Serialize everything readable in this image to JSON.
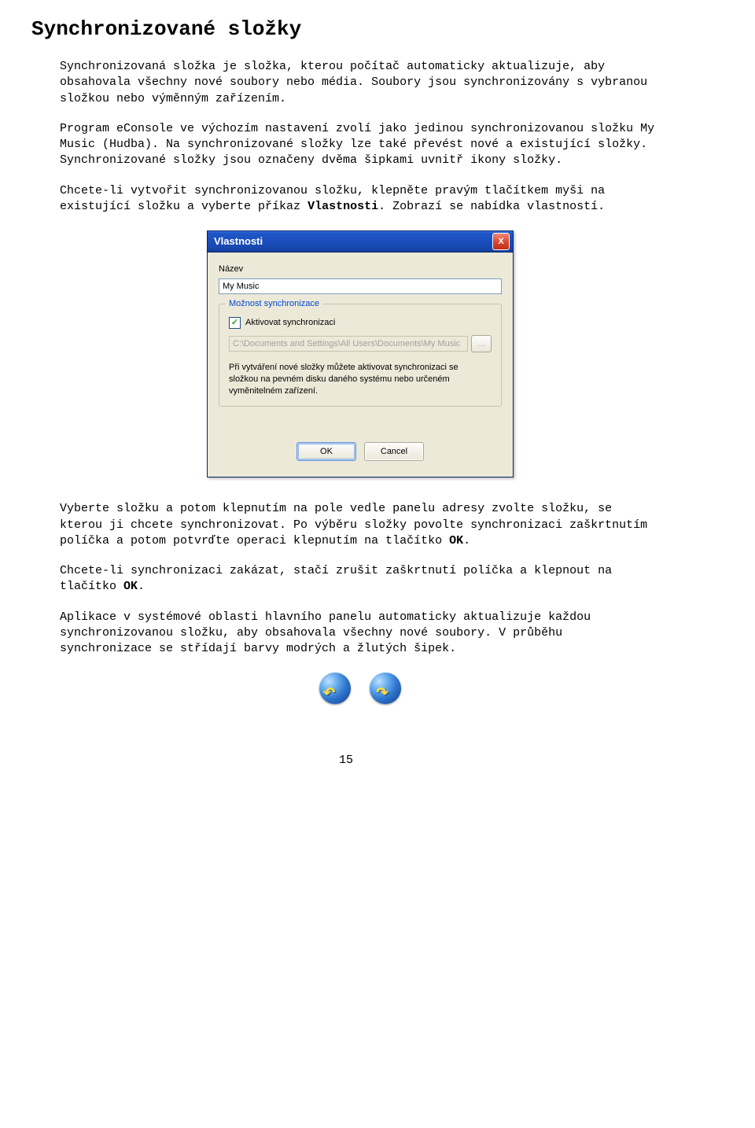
{
  "heading": "Synchronizované složky",
  "para1": "Synchronizovaná složka je složka, kterou počítač automaticky aktualizuje, aby obsahovala všechny nové soubory nebo média. Soubory jsou synchronizovány s vybranou složkou nebo výměnným zařízením.",
  "para2": "Program eConsole ve výchozím nastavení zvolí jako jedinou synchronizovanou složku My Music (Hudba). Na synchronizované složky lze také převést nové a existující složky. Synchronizované složky jsou označeny dvěma šipkami uvnitř ikony složky.",
  "para3a": "Chcete-li vytvořit synchronizovanou složku, klepněte pravým tlačítkem myši na existující složku a vyberte příkaz ",
  "para3b": "Vlastnosti",
  "para3c": ". Zobrazí se nabídka vlastností.",
  "dialog": {
    "title": "Vlastnosti",
    "close": "X",
    "name_label": "Název",
    "name_value": "My Music",
    "group_title": "Možnost synchronizace",
    "checkbox_label": "Aktivovat synchronizaci",
    "path": "C:\\Documents and Settings\\All Users\\Documents\\My Music",
    "browse": "...",
    "help": "Při vytváření nové složky můžete aktivovat synchronizaci se složkou na pevném disku daného systému nebo určeném vyměnitelném zařízení.",
    "ok": "OK",
    "cancel": "Cancel"
  },
  "para4a": "Vyberte složku a potom klepnutím na pole vedle panelu adresy zvolte složku, se kterou ji chcete synchronizovat. Po výběru složky povolte synchronizaci zaškrtnutím políčka a potom potvrďte operaci klepnutím na tlačítko ",
  "para4b": "OK",
  "para4c": ".",
  "para5a": "Chcete-li synchronizaci zakázat, stačí zrušit zaškrtnutí políčka a klepnout na tlačítko ",
  "para5b": "OK",
  "para5c": ".",
  "para6": "Aplikace v systémové oblasti hlavního panelu automaticky aktualizuje každou synchronizovanou složku, aby obsahovala všechny nové soubory. V průběhu synchronizace se střídají barvy modrých a žlutých šipek.",
  "pagenum": "15"
}
